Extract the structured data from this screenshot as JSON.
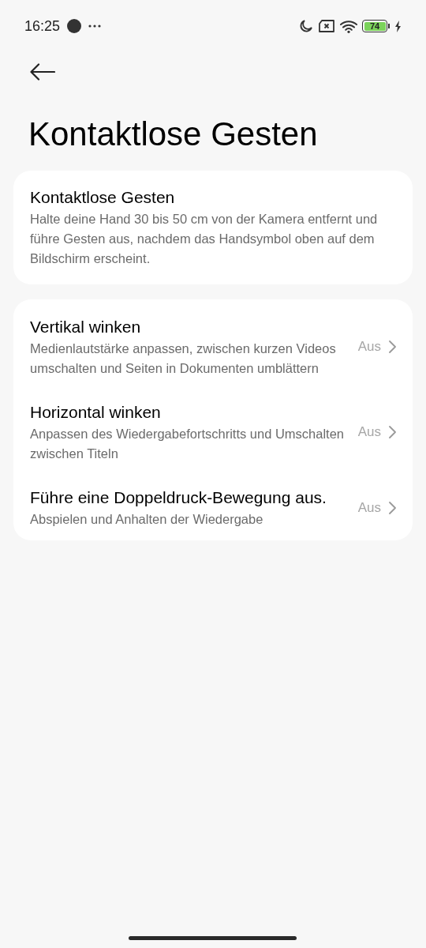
{
  "status_bar": {
    "time": "16:25",
    "battery": "74"
  },
  "page": {
    "title": "Kontaktlose Gesten"
  },
  "info_card": {
    "title": "Kontaktlose Gesten",
    "description": "Halte deine Hand 30 bis 50 cm von der Kamera entfernt und führe Gesten aus, nachdem das Handsymbol oben auf dem Bildschirm erscheint."
  },
  "settings": [
    {
      "title": "Vertikal winken",
      "description": "Medienlautstärke anpassen, zwischen kurzen Videos umschalten und Seiten in Dokumenten umblättern",
      "value": "Aus"
    },
    {
      "title": "Horizontal winken",
      "description": "Anpassen des Wiedergabefortschritts und Umschalten zwischen Titeln",
      "value": "Aus"
    },
    {
      "title": "Führe eine Doppeldruck-Bewegung aus.",
      "description": "Abspielen und Anhalten der Wiedergabe",
      "value": "Aus"
    }
  ]
}
